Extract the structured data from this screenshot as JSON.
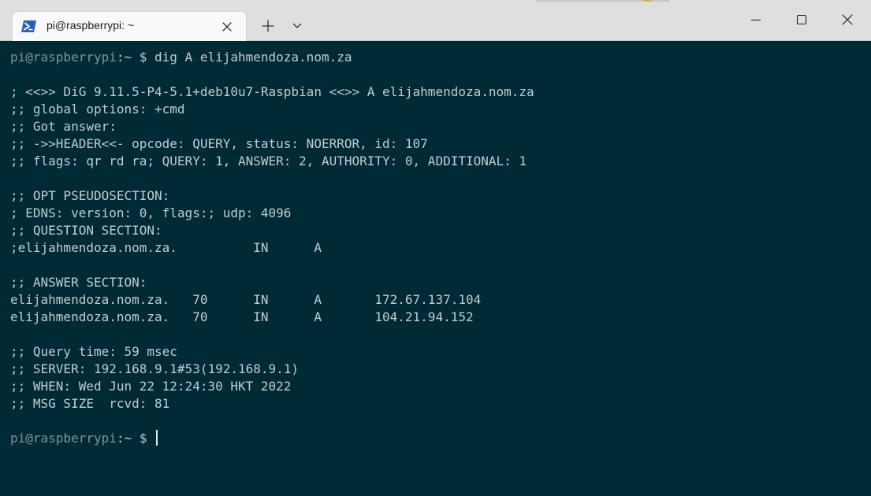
{
  "window": {
    "tab_title": "pi@raspberrypi: ~",
    "tab_icon": "powershell-icon",
    "controls": [
      "new-tab",
      "tab-dropdown",
      "minimize",
      "maximize",
      "close"
    ]
  },
  "colors": {
    "terminal_bg": "#002b36",
    "terminal_fg": "#c2cccc",
    "prompt_user": "#839496",
    "titlebar_bg": "#dfdfdf"
  },
  "terminal": {
    "prompt_user": "pi@raspberrypi",
    "prompt_suffix": ":~ $",
    "command": " dig A elijahmendoza.nom.za",
    "output": [
      "",
      "; <<>> DiG 9.11.5-P4-5.1+deb10u7-Raspbian <<>> A elijahmendoza.nom.za",
      ";; global options: +cmd",
      ";; Got answer:",
      ";; ->>HEADER<<- opcode: QUERY, status: NOERROR, id: 107",
      ";; flags: qr rd ra; QUERY: 1, ANSWER: 2, AUTHORITY: 0, ADDITIONAL: 1",
      "",
      ";; OPT PSEUDOSECTION:",
      "; EDNS: version: 0, flags:; udp: 4096",
      ";; QUESTION SECTION:",
      ";elijahmendoza.nom.za.          IN      A",
      "",
      ";; ANSWER SECTION:",
      "elijahmendoza.nom.za.   70      IN      A       172.67.137.104",
      "elijahmendoza.nom.za.   70      IN      A       104.21.94.152",
      "",
      ";; Query time: 59 msec",
      ";; SERVER: 192.168.9.1#53(192.168.9.1)",
      ";; WHEN: Wed Jun 22 12:24:30 HKT 2022",
      ";; MSG SIZE  rcvd: 81",
      ""
    ],
    "final_prompt_user": "pi@raspberrypi",
    "final_prompt_suffix": ":~ $ "
  }
}
